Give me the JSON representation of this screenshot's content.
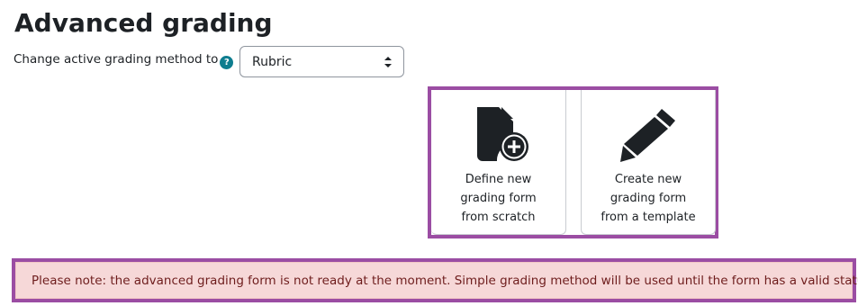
{
  "page": {
    "title": "Advanced grading"
  },
  "method": {
    "label": "Change active grading method to",
    "help_icon": "question-circle-icon",
    "selected": "Rubric"
  },
  "actions": [
    {
      "label": "Define new\ngrading form\nfrom scratch",
      "icon": "file-plus-icon"
    },
    {
      "label": "Create new\ngrading form\nfrom a template",
      "icon": "pencil-icon"
    }
  ],
  "notice": {
    "text": "Please note: the advanced grading form is not ready at the moment. Simple grading method will be used until the form has a valid status."
  },
  "colors": {
    "highlight": "#9b4da3",
    "help_icon": "#0e7d8f",
    "notice_bg": "#f6d8d8",
    "notice_text": "#6e1d1d"
  }
}
